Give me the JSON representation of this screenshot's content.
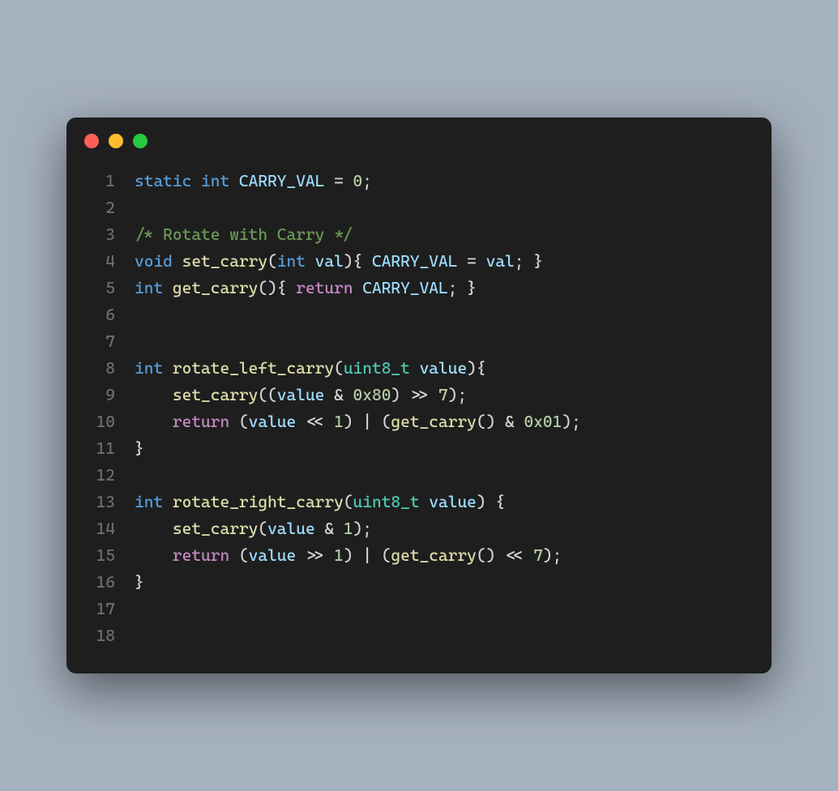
{
  "window": {
    "traffic_lights": [
      "red",
      "yellow",
      "green"
    ]
  },
  "code": {
    "lines": [
      {
        "no": 1,
        "tokens": [
          {
            "t": "static",
            "c": "kw"
          },
          {
            "t": " ",
            "c": "punc"
          },
          {
            "t": "int",
            "c": "kw"
          },
          {
            "t": " ",
            "c": "punc"
          },
          {
            "t": "CARRY_VAL",
            "c": "var"
          },
          {
            "t": " = ",
            "c": "punc"
          },
          {
            "t": "0",
            "c": "num"
          },
          {
            "t": ";",
            "c": "punc"
          }
        ]
      },
      {
        "no": 2,
        "tokens": []
      },
      {
        "no": 3,
        "tokens": [
          {
            "t": "/* Rotate with Carry */",
            "c": "cmt"
          }
        ]
      },
      {
        "no": 4,
        "tokens": [
          {
            "t": "void",
            "c": "kw"
          },
          {
            "t": " ",
            "c": "punc"
          },
          {
            "t": "set_carry",
            "c": "fn"
          },
          {
            "t": "(",
            "c": "punc"
          },
          {
            "t": "int",
            "c": "kw"
          },
          {
            "t": " ",
            "c": "punc"
          },
          {
            "t": "val",
            "c": "var"
          },
          {
            "t": "){ ",
            "c": "punc"
          },
          {
            "t": "CARRY_VAL",
            "c": "var"
          },
          {
            "t": " = ",
            "c": "punc"
          },
          {
            "t": "val",
            "c": "var"
          },
          {
            "t": "; }",
            "c": "punc"
          }
        ]
      },
      {
        "no": 5,
        "tokens": [
          {
            "t": "int",
            "c": "kw"
          },
          {
            "t": " ",
            "c": "punc"
          },
          {
            "t": "get_carry",
            "c": "fn"
          },
          {
            "t": "(){ ",
            "c": "punc"
          },
          {
            "t": "return",
            "c": "ret"
          },
          {
            "t": " ",
            "c": "punc"
          },
          {
            "t": "CARRY_VAL",
            "c": "var"
          },
          {
            "t": "; }",
            "c": "punc"
          }
        ]
      },
      {
        "no": 6,
        "tokens": []
      },
      {
        "no": 7,
        "tokens": []
      },
      {
        "no": 8,
        "tokens": [
          {
            "t": "int",
            "c": "kw"
          },
          {
            "t": " ",
            "c": "punc"
          },
          {
            "t": "rotate_left_carry",
            "c": "fn"
          },
          {
            "t": "(",
            "c": "punc"
          },
          {
            "t": "uint8_t",
            "c": "type"
          },
          {
            "t": " ",
            "c": "punc"
          },
          {
            "t": "value",
            "c": "var"
          },
          {
            "t": "){",
            "c": "punc"
          }
        ]
      },
      {
        "no": 9,
        "tokens": [
          {
            "t": "    ",
            "c": "punc"
          },
          {
            "t": "set_carry",
            "c": "fn"
          },
          {
            "t": "((",
            "c": "punc"
          },
          {
            "t": "value",
            "c": "var"
          },
          {
            "t": " & ",
            "c": "punc"
          },
          {
            "t": "0x80",
            "c": "num"
          },
          {
            "t": ") >> ",
            "c": "punc"
          },
          {
            "t": "7",
            "c": "num"
          },
          {
            "t": ");",
            "c": "punc"
          }
        ]
      },
      {
        "no": 10,
        "tokens": [
          {
            "t": "    ",
            "c": "punc"
          },
          {
            "t": "return",
            "c": "ret"
          },
          {
            "t": " (",
            "c": "punc"
          },
          {
            "t": "value",
            "c": "var"
          },
          {
            "t": " << ",
            "c": "punc"
          },
          {
            "t": "1",
            "c": "num"
          },
          {
            "t": ") | (",
            "c": "punc"
          },
          {
            "t": "get_carry",
            "c": "fn"
          },
          {
            "t": "() & ",
            "c": "punc"
          },
          {
            "t": "0x01",
            "c": "num"
          },
          {
            "t": ");",
            "c": "punc"
          }
        ]
      },
      {
        "no": 11,
        "tokens": [
          {
            "t": "}",
            "c": "punc"
          }
        ]
      },
      {
        "no": 12,
        "tokens": []
      },
      {
        "no": 13,
        "tokens": [
          {
            "t": "int",
            "c": "kw"
          },
          {
            "t": " ",
            "c": "punc"
          },
          {
            "t": "rotate_right_carry",
            "c": "fn"
          },
          {
            "t": "(",
            "c": "punc"
          },
          {
            "t": "uint8_t",
            "c": "type"
          },
          {
            "t": " ",
            "c": "punc"
          },
          {
            "t": "value",
            "c": "var"
          },
          {
            "t": ") {",
            "c": "punc"
          }
        ]
      },
      {
        "no": 14,
        "tokens": [
          {
            "t": "    ",
            "c": "punc"
          },
          {
            "t": "set_carry",
            "c": "fn"
          },
          {
            "t": "(",
            "c": "punc"
          },
          {
            "t": "value",
            "c": "var"
          },
          {
            "t": " & ",
            "c": "punc"
          },
          {
            "t": "1",
            "c": "num"
          },
          {
            "t": ");",
            "c": "punc"
          }
        ]
      },
      {
        "no": 15,
        "tokens": [
          {
            "t": "    ",
            "c": "punc"
          },
          {
            "t": "return",
            "c": "ret"
          },
          {
            "t": " (",
            "c": "punc"
          },
          {
            "t": "value",
            "c": "var"
          },
          {
            "t": " >> ",
            "c": "punc"
          },
          {
            "t": "1",
            "c": "num"
          },
          {
            "t": ") | (",
            "c": "punc"
          },
          {
            "t": "get_carry",
            "c": "fn"
          },
          {
            "t": "() << ",
            "c": "punc"
          },
          {
            "t": "7",
            "c": "num"
          },
          {
            "t": ");",
            "c": "punc"
          }
        ]
      },
      {
        "no": 16,
        "tokens": [
          {
            "t": "}",
            "c": "punc"
          }
        ]
      },
      {
        "no": 17,
        "tokens": []
      },
      {
        "no": 18,
        "tokens": []
      }
    ]
  }
}
